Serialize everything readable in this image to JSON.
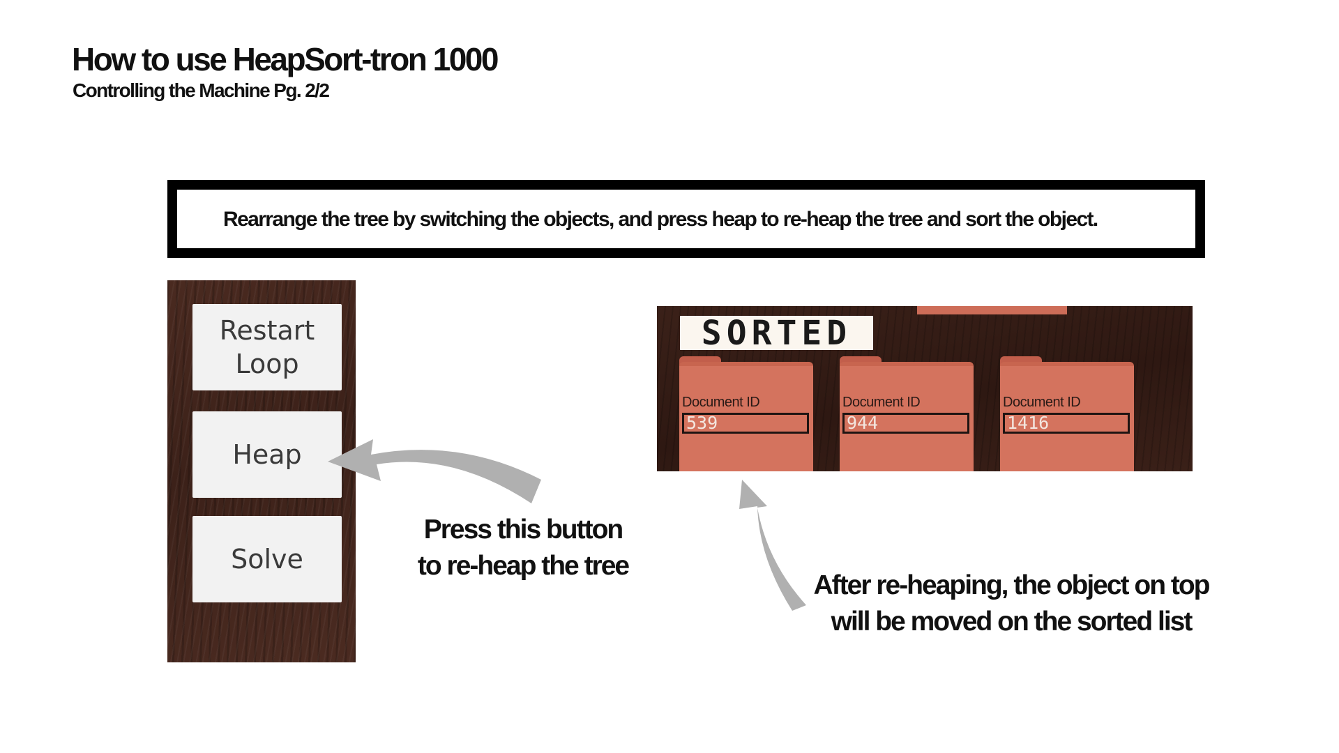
{
  "header": {
    "title": "How to use HeapSort-tron 1000",
    "subtitle": "Controlling the Machine Pg. 2/2"
  },
  "instruction": "Rearrange the tree by switching the objects, and press heap to re-heap the tree and sort the object.",
  "control_panel": {
    "buttons": [
      {
        "label": "Restart\nLoop"
      },
      {
        "label": "Heap"
      },
      {
        "label": "Solve"
      }
    ]
  },
  "callouts": {
    "heap_button": "Press this button to re-heap the tree",
    "sorted_list": "After re-heaping, the object on top will be moved on the sorted list"
  },
  "sorted_panel": {
    "label": "SORTED",
    "documents": [
      {
        "label": "Document ID",
        "value": "539"
      },
      {
        "label": "Document ID",
        "value": "944"
      },
      {
        "label": "Document ID",
        "value": "1416"
      }
    ]
  },
  "colors": {
    "folder": "#d4735e",
    "wood": "#3c2119",
    "arrow": "#b0b0b0"
  }
}
